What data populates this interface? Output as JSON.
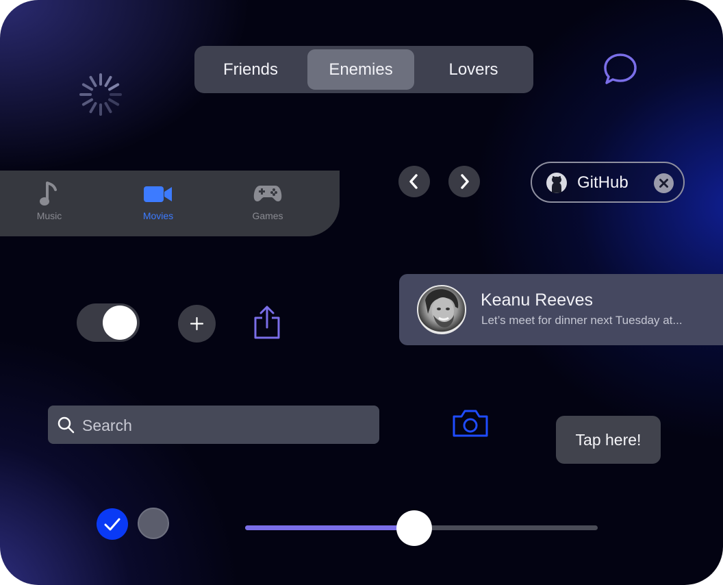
{
  "segmented": {
    "items": [
      "Friends",
      "Enemies",
      "Lovers"
    ],
    "selected_index": 1
  },
  "tabbar": {
    "items": [
      {
        "label": "Music",
        "icon": "music-note-icon"
      },
      {
        "label": "Movies",
        "icon": "video-camera-icon"
      },
      {
        "label": "Games",
        "icon": "gamepad-icon"
      }
    ],
    "selected_index": 1,
    "active_color": "#3d7bff"
  },
  "chip": {
    "label": "GitHub",
    "icon": "github-icon",
    "close_icon": "close-icon"
  },
  "notification": {
    "name": "Keanu Reeves",
    "message": "Let’s meet for dinner next Tuesday at..."
  },
  "search": {
    "placeholder": "Search",
    "value": ""
  },
  "tooltip": {
    "label": "Tap here!"
  },
  "toggle": {
    "on": true
  },
  "checkbox": {
    "checked": true,
    "checked_color": "#0a3af5"
  },
  "radio": {
    "checked": false
  },
  "slider": {
    "value": 0.48,
    "fill_color": "#7a6ee8"
  },
  "colors": {
    "accent_purple": "#7a6ee8",
    "accent_blue": "#1f4cff"
  }
}
